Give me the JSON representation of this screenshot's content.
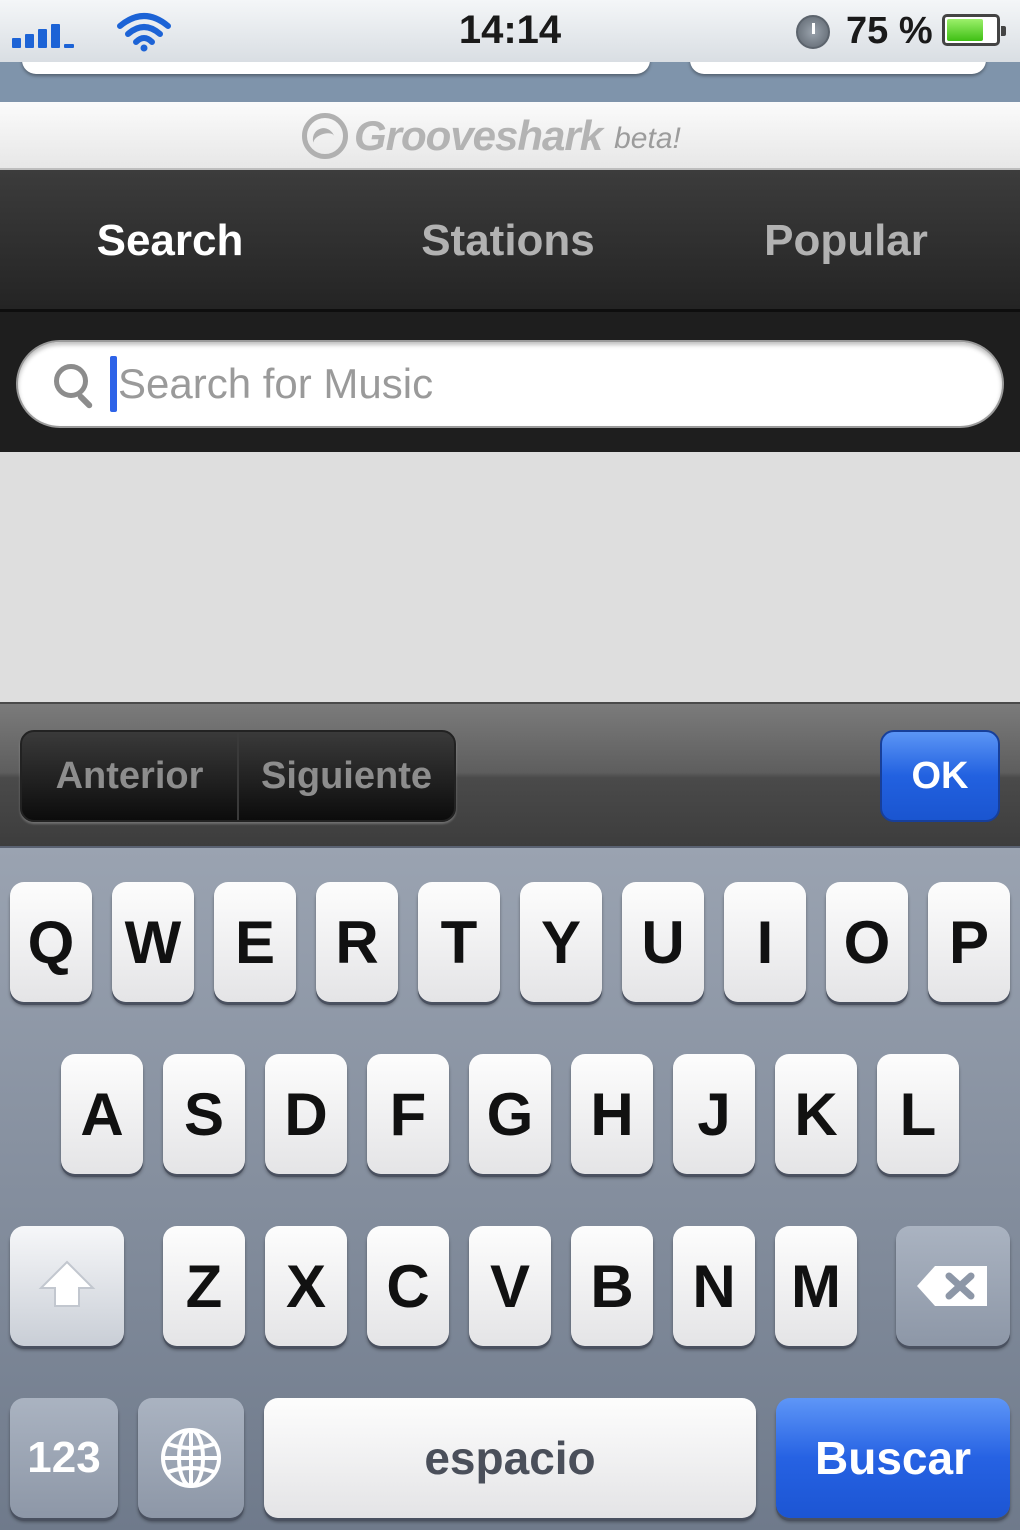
{
  "status_bar": {
    "time": "14:14",
    "battery_percent": "75 %",
    "battery_level": 0.75,
    "icons": [
      "signal-icon",
      "wifi-icon",
      "clock-icon",
      "battery-icon"
    ]
  },
  "logo": {
    "name": "Grooveshark",
    "suffix": "beta!"
  },
  "tabs": [
    {
      "label": "Search",
      "active": true
    },
    {
      "label": "Stations",
      "active": false
    },
    {
      "label": "Popular",
      "active": false
    }
  ],
  "search": {
    "placeholder": "Search for Music",
    "value": ""
  },
  "accessory": {
    "prev_label": "Anterior",
    "next_label": "Siguiente",
    "done_label": "OK"
  },
  "keyboard": {
    "row1": [
      "Q",
      "W",
      "E",
      "R",
      "T",
      "Y",
      "U",
      "I",
      "O",
      "P"
    ],
    "row2": [
      "A",
      "S",
      "D",
      "F",
      "G",
      "H",
      "J",
      "K",
      "L"
    ],
    "row3": [
      "Z",
      "X",
      "C",
      "V",
      "B",
      "N",
      "M"
    ],
    "numbers_label": "123",
    "space_label": "espacio",
    "return_label": "Buscar"
  },
  "colors": {
    "accent_blue": "#2662e3",
    "tab_bar": "#2e2e2e",
    "keyboard_bg": "#8590a0"
  }
}
